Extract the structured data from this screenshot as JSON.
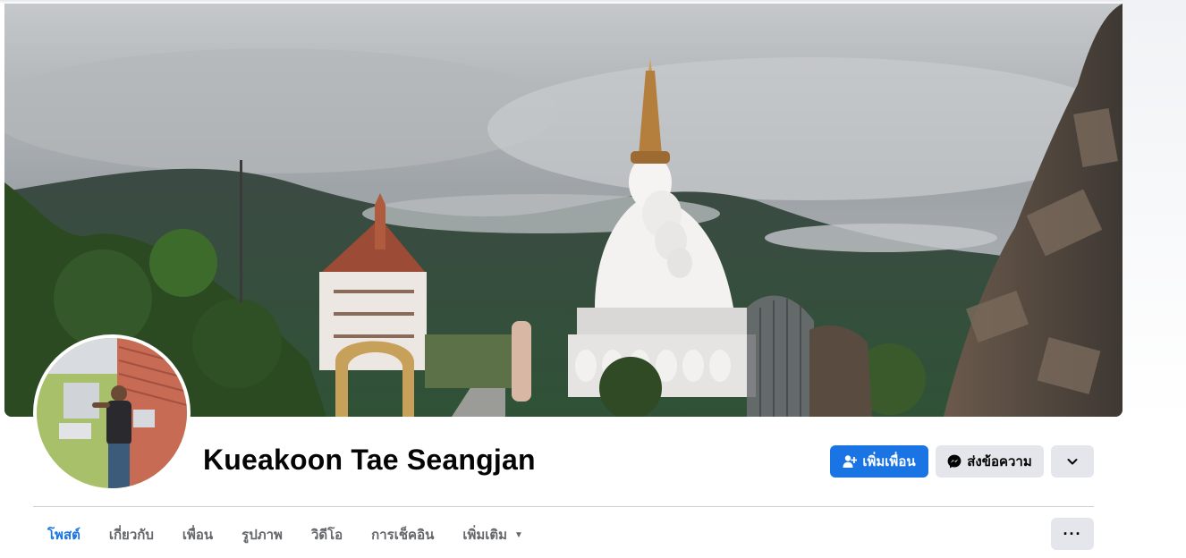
{
  "profile": {
    "name": "Kueakoon Tae Seangjan",
    "cover_photo": "temple-mountain-cover-photo",
    "avatar_photo": "man-beside-air-conditioner-photo"
  },
  "actions": {
    "add_friend_label": "เพิ่มเพื่อน",
    "add_friend_icon": "person-add-icon",
    "message_label": "ส่งข้อความ",
    "message_icon": "messenger-icon",
    "more_icon": "chevron-down-icon"
  },
  "tabs": [
    {
      "label": "โพสต์",
      "active": true
    },
    {
      "label": "เกี่ยวกับ",
      "active": false
    },
    {
      "label": "เพื่อน",
      "active": false
    },
    {
      "label": "รูปภาพ",
      "active": false
    },
    {
      "label": "วิดีโอ",
      "active": false
    },
    {
      "label": "การเช็คอิน",
      "active": false
    },
    {
      "label": "เพิ่มเติม",
      "active": false,
      "dropdown": true
    }
  ],
  "tab_actions": {
    "dots_label": "···"
  },
  "colors": {
    "accent": "#1b74e4",
    "button_gray": "#e4e6eb",
    "muted_text": "#65676b",
    "divider": "#ced0d4"
  }
}
